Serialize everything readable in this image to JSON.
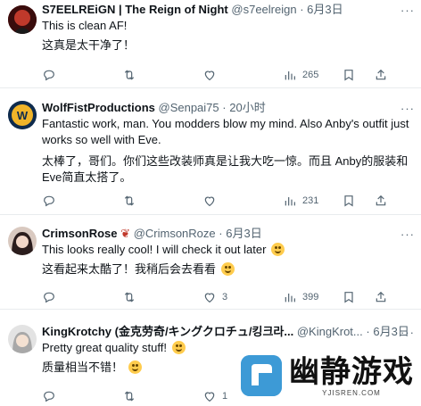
{
  "tweets": [
    {
      "name": "S7EELREiGN | The Reign of Night",
      "handle": "@s7eelreign",
      "separator": "·",
      "time": "6月3日",
      "text": [
        "This is clean AF!",
        "这真是太干净了！"
      ],
      "replies": "",
      "retweets": "",
      "likes": "",
      "views": "265"
    },
    {
      "name": "WolfFistProductions",
      "handle": "@Senpai75",
      "separator": "·",
      "time": "20小时",
      "text": [
        "Fantastic work, man. You modders blow my mind. Also Anby's outfit just works so well with Eve.",
        "太棒了，哥们。你们这些改装师真是让我大吃一惊。而且 Anby的服装和 Eve简直太搭了。"
      ],
      "replies": "",
      "retweets": "",
      "likes": "",
      "views": "231"
    },
    {
      "name": "CrimsonRose",
      "handle": "@CrimsonRoze",
      "separator": "·",
      "time": "6月3日",
      "text": [
        "This looks really cool! I will check it out later",
        "这看起来太酷了！我稍后会去看看"
      ],
      "replies": "",
      "retweets": "",
      "likes": "3",
      "views": "399"
    },
    {
      "name": "KingKrotchy (金克劳奇/キングクロチュ/킹크라...",
      "handle": "@KingKrot...",
      "separator": "·",
      "time": "6月3日",
      "text": [
        "Pretty great quality stuff!",
        "质量相当不错！"
      ],
      "replies": "",
      "retweets": "",
      "likes": "1",
      "views": ""
    }
  ],
  "more_label": "···",
  "watermark": {
    "title": "幽静游戏",
    "sub": "YJISREN.COM"
  },
  "colors": {
    "text": "#0f1419",
    "muted": "#536471",
    "divider": "#e8ecee"
  }
}
